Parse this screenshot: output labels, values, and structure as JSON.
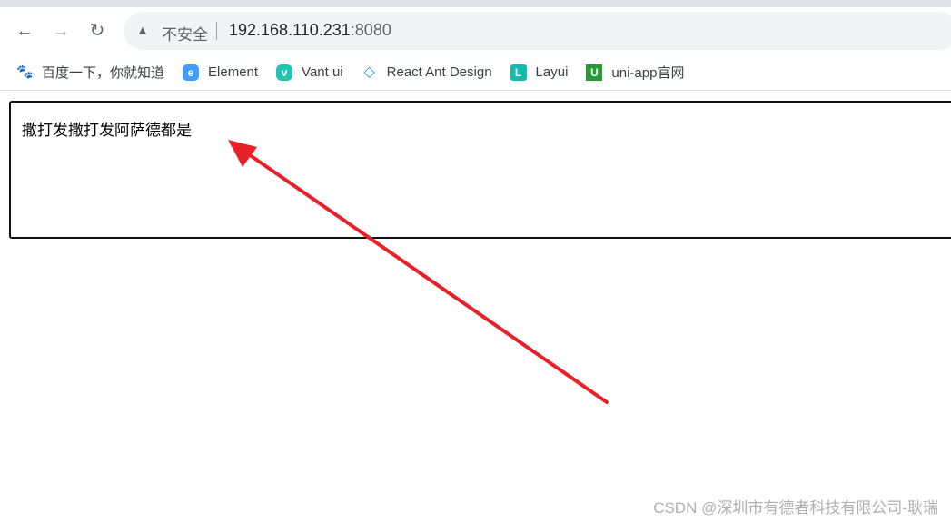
{
  "browser": {
    "security_label": "不安全",
    "url_host": "192.168.110.231",
    "url_port": ":8080",
    "bookmarks": [
      {
        "label": "百度一下，你就知道",
        "icon": "baidu-paw-icon",
        "color": "#2932e1"
      },
      {
        "label": "Element",
        "icon": "element-logo-icon",
        "color": "#409eff"
      },
      {
        "label": "Vant ui",
        "icon": "vant-logo-icon",
        "color": "#1fc7b0"
      },
      {
        "label": "React Ant Design",
        "icon": "antd-logo-icon",
        "color": "#1890ff"
      },
      {
        "label": "Layui",
        "icon": "layui-logo-icon",
        "color": "#16baaa"
      },
      {
        "label": "uni-app官网",
        "icon": "uniapp-logo-icon",
        "color": "#2b9939"
      }
    ]
  },
  "page": {
    "textarea_value": "撒打发撒打发阿萨德都是"
  },
  "annotation": {
    "arrow_color": "#e8202a"
  },
  "watermark": "CSDN @深圳市有德者科技有限公司-耿瑞"
}
